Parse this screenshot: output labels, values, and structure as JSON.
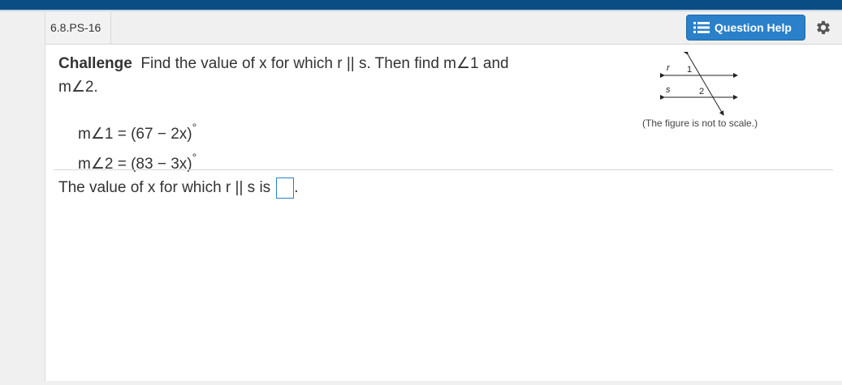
{
  "header": {
    "problem_id": "6.8.PS-16",
    "help_button_label": "Question Help",
    "help_icon": "list-icon",
    "settings_icon": "gear-icon"
  },
  "question": {
    "challenge_label": "Challenge",
    "prompt_line1": "Find the value of x for which r || s. Then find m∠1 and",
    "prompt_line2": "m∠2.",
    "angle1_expr": "m∠1 = (67 − 2x)",
    "angle2_expr": "m∠2 = (83 − 3x)",
    "degree_symbol": "°"
  },
  "figure": {
    "label_r": "r",
    "label_s": "s",
    "label_1": "1",
    "label_2": "2",
    "caption": "(The figure is not to scale.)"
  },
  "answer": {
    "prompt": "The value of x for which r || s is",
    "suffix": ".",
    "value": ""
  },
  "colors": {
    "topbar": "#0a4d85",
    "button": "#2a80c9"
  }
}
